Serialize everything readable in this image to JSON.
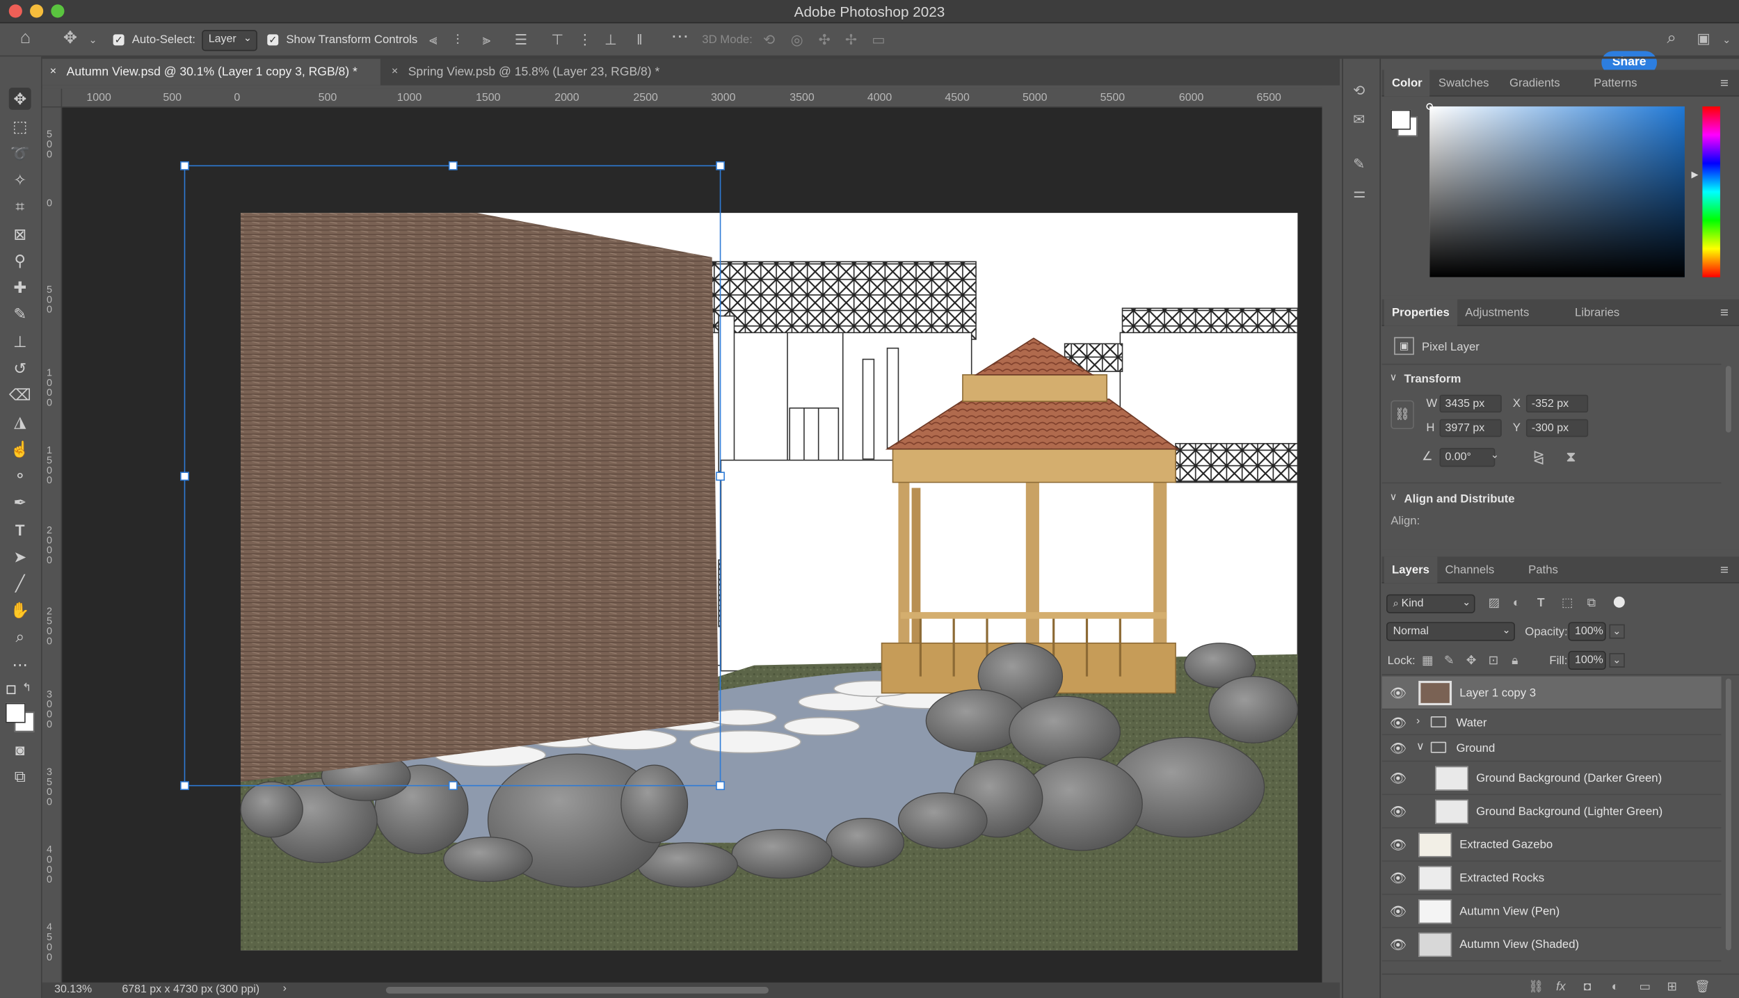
{
  "window": {
    "title": "Adobe Photoshop 2023"
  },
  "options_bar": {
    "auto_select_label": "Auto-Select:",
    "auto_select_value": "Layer",
    "show_transform_label": "Show Transform Controls",
    "mode_3d_label": "3D Mode:",
    "share_label": "Share"
  },
  "tabs": [
    {
      "label": "Autumn View.psd @ 30.1% (Layer 1 copy 3, RGB/8) *",
      "active": true
    },
    {
      "label": "Spring View.psb @ 15.8% (Layer 23, RGB/8) *",
      "active": false
    }
  ],
  "ruler": {
    "h_labels": [
      "1000",
      "500",
      "0",
      "500",
      "1000",
      "1500",
      "2000",
      "2500",
      "3000",
      "3500",
      "4000",
      "4500",
      "5000",
      "5500",
      "6000",
      "6500"
    ],
    "v_labels": [
      "500",
      "0",
      "500",
      "1000",
      "1500",
      "2000",
      "2500",
      "3000",
      "3500",
      "4000",
      "4500"
    ]
  },
  "status": {
    "zoom": "30.13%",
    "doc_info": "6781 px x 4730 px (300 ppi)"
  },
  "color_panel": {
    "tabs": [
      "Color",
      "Swatches",
      "Gradients",
      "Patterns"
    ],
    "base_hue": "#1f78d6"
  },
  "properties_panel": {
    "tabs": [
      "Properties",
      "Adjustments",
      "Libraries"
    ],
    "layer_type": "Pixel Layer",
    "transform_label": "Transform",
    "w_label": "W",
    "w_value": "3435 px",
    "h_label": "H",
    "h_value": "3977 px",
    "x_label": "X",
    "x_value": "-352 px",
    "y_label": "Y",
    "y_value": "-300 px",
    "angle_value": "0.00°",
    "align_distribute_label": "Align and Distribute",
    "align_label": "Align:"
  },
  "layers_panel": {
    "tabs": [
      "Layers",
      "Channels",
      "Paths"
    ],
    "filter_kind": "Kind",
    "blend_mode": "Normal",
    "opacity_label": "Opacity:",
    "opacity_value": "100%",
    "lock_label": "Lock:",
    "fill_label": "Fill:",
    "fill_value": "100%",
    "layers": [
      {
        "name": "Layer 1 copy 3",
        "type": "pixel",
        "selected": true
      },
      {
        "name": "Water",
        "type": "group",
        "expanded": false
      },
      {
        "name": "Ground",
        "type": "group",
        "expanded": true
      },
      {
        "name": "Ground Background (Darker Green)",
        "type": "pixel",
        "indent": true
      },
      {
        "name": "Ground Background (Lighter Green)",
        "type": "pixel",
        "indent": true
      },
      {
        "name": "Extracted Gazebo",
        "type": "pixel"
      },
      {
        "name": "Extracted Rocks",
        "type": "pixel"
      },
      {
        "name": "Autumn View (Pen)",
        "type": "pixel"
      },
      {
        "name": "Autumn View (Shaded)",
        "type": "pixel"
      }
    ]
  }
}
